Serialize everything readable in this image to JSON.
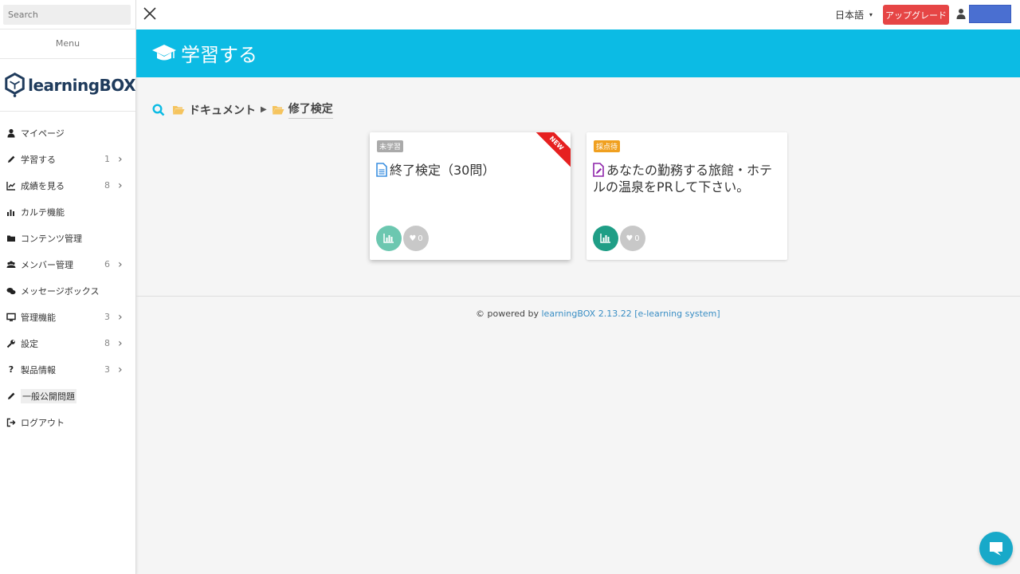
{
  "sidebar": {
    "search_placeholder": "Search",
    "menu_label": "Menu",
    "logo_text": "learningBOX",
    "items": [
      {
        "label": "マイページ",
        "count": "",
        "icon": "user-icon"
      },
      {
        "label": "学習する",
        "count": "1",
        "icon": "pencil-icon"
      },
      {
        "label": "成績を見る",
        "count": "8",
        "icon": "line-chart-icon"
      },
      {
        "label": "カルテ機能",
        "count": "",
        "icon": "bar-chart-icon"
      },
      {
        "label": "コンテンツ管理",
        "count": "",
        "icon": "folder-icon"
      },
      {
        "label": "メンバー管理",
        "count": "6",
        "icon": "users-icon"
      },
      {
        "label": "メッセージボックス",
        "count": "",
        "icon": "comments-icon"
      },
      {
        "label": "管理機能",
        "count": "3",
        "icon": "desktop-icon"
      },
      {
        "label": "設定",
        "count": "8",
        "icon": "wrench-icon"
      },
      {
        "label": "製品情報",
        "count": "3",
        "icon": "question-icon"
      },
      {
        "label": "一般公開問題",
        "count": "",
        "icon": "pencil-icon"
      },
      {
        "label": "ログアウト",
        "count": "",
        "icon": "sign-out-icon"
      }
    ]
  },
  "topbar": {
    "language": "日本語",
    "upgrade_label": "アップグレード"
  },
  "header": {
    "title": "学習する"
  },
  "breadcrumb": {
    "items": [
      "ドキュメント",
      "修了検定"
    ]
  },
  "cards": [
    {
      "status": "未学習",
      "ribbon": "NEW",
      "title": "終了検定（30問）",
      "likes": "0"
    },
    {
      "status": "採点待",
      "ribbon": "",
      "title": "あなたの勤務する旅館・ホテルの温泉をPRして下さい。",
      "likes": "0"
    }
  ],
  "footer": {
    "prefix": "© powered by ",
    "link": "learningBOX 2.13.22 [e-learning system]"
  },
  "colors": {
    "accent": "#0cbbe4",
    "upgrade": "#e64545",
    "status_unlearned": "#aaaaaa",
    "status_pending": "#f0a020",
    "stat_button_light": "#6cc7b0",
    "stat_button_dark": "#1f9e86"
  }
}
